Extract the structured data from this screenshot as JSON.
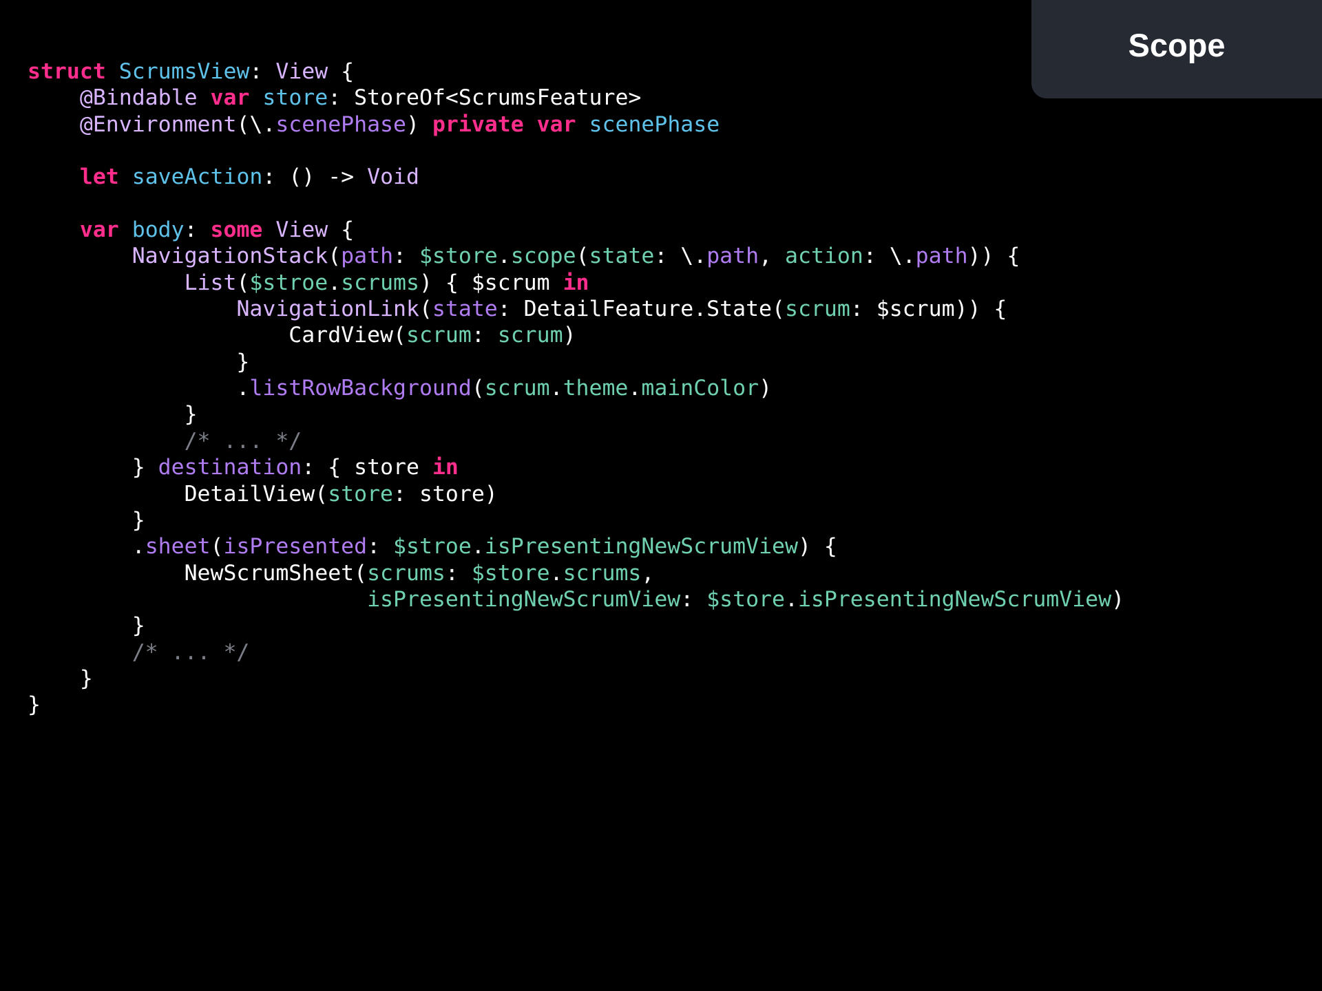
{
  "title_tab": {
    "title": "Scope"
  },
  "palette": {
    "background": "#000000",
    "tab_background": "#262a33",
    "keyword": "#ff2e8c",
    "type": "#d9b5ff",
    "name": "#5ec2ea",
    "member": "#b07cf2",
    "argument": "#6fd1b0",
    "comment": "#7b7f88",
    "plain": "#ffffff"
  },
  "code_lines": [
    [
      {
        "t": "struct",
        "k": "kw"
      },
      {
        "t": " ",
        "k": "plain"
      },
      {
        "t": "ScrumsView",
        "k": "name"
      },
      {
        "t": ": ",
        "k": "plain"
      },
      {
        "t": "View",
        "k": "type"
      },
      {
        "t": " {",
        "k": "plain"
      }
    ],
    [
      {
        "t": "    ",
        "k": "plain"
      },
      {
        "t": "@Bindable",
        "k": "attr"
      },
      {
        "t": " ",
        "k": "plain"
      },
      {
        "t": "var",
        "k": "kw"
      },
      {
        "t": " ",
        "k": "plain"
      },
      {
        "t": "store",
        "k": "name"
      },
      {
        "t": ": StoreOf<ScrumsFeature>",
        "k": "plain"
      }
    ],
    [
      {
        "t": "    ",
        "k": "plain"
      },
      {
        "t": "@Environment",
        "k": "attr"
      },
      {
        "t": "(\\.",
        "k": "plain"
      },
      {
        "t": "scenePhase",
        "k": "member"
      },
      {
        "t": ") ",
        "k": "plain"
      },
      {
        "t": "private",
        "k": "kw"
      },
      {
        "t": " ",
        "k": "plain"
      },
      {
        "t": "var",
        "k": "kw"
      },
      {
        "t": " ",
        "k": "plain"
      },
      {
        "t": "scenePhase",
        "k": "name"
      }
    ],
    [],
    [
      {
        "t": "    ",
        "k": "plain"
      },
      {
        "t": "let",
        "k": "kw"
      },
      {
        "t": " ",
        "k": "plain"
      },
      {
        "t": "saveAction",
        "k": "name"
      },
      {
        "t": ": () -> ",
        "k": "plain"
      },
      {
        "t": "Void",
        "k": "type"
      }
    ],
    [],
    [
      {
        "t": "    ",
        "k": "plain"
      },
      {
        "t": "var",
        "k": "kw"
      },
      {
        "t": " ",
        "k": "plain"
      },
      {
        "t": "body",
        "k": "name"
      },
      {
        "t": ": ",
        "k": "plain"
      },
      {
        "t": "some",
        "k": "kw"
      },
      {
        "t": " ",
        "k": "plain"
      },
      {
        "t": "View",
        "k": "type"
      },
      {
        "t": " {",
        "k": "plain"
      }
    ],
    [
      {
        "t": "        ",
        "k": "plain"
      },
      {
        "t": "NavigationStack",
        "k": "type"
      },
      {
        "t": "(",
        "k": "plain"
      },
      {
        "t": "path",
        "k": "member"
      },
      {
        "t": ": ",
        "k": "plain"
      },
      {
        "t": "$store",
        "k": "arg"
      },
      {
        "t": ".",
        "k": "plain"
      },
      {
        "t": "scope",
        "k": "arg"
      },
      {
        "t": "(",
        "k": "plain"
      },
      {
        "t": "state",
        "k": "arg"
      },
      {
        "t": ": \\.",
        "k": "plain"
      },
      {
        "t": "path",
        "k": "member"
      },
      {
        "t": ", ",
        "k": "plain"
      },
      {
        "t": "action",
        "k": "arg"
      },
      {
        "t": ": \\.",
        "k": "plain"
      },
      {
        "t": "path",
        "k": "member"
      },
      {
        "t": ")) {",
        "k": "plain"
      }
    ],
    [
      {
        "t": "            ",
        "k": "plain"
      },
      {
        "t": "List",
        "k": "type"
      },
      {
        "t": "(",
        "k": "plain"
      },
      {
        "t": "$stroe",
        "k": "arg"
      },
      {
        "t": ".",
        "k": "plain"
      },
      {
        "t": "scrums",
        "k": "arg"
      },
      {
        "t": ") { $scrum ",
        "k": "plain"
      },
      {
        "t": "in",
        "k": "kw"
      }
    ],
    [
      {
        "t": "                ",
        "k": "plain"
      },
      {
        "t": "NavigationLink",
        "k": "type"
      },
      {
        "t": "(",
        "k": "plain"
      },
      {
        "t": "state",
        "k": "member"
      },
      {
        "t": ": DetailFeature.State(",
        "k": "plain"
      },
      {
        "t": "scrum",
        "k": "arg"
      },
      {
        "t": ": $scrum)) {",
        "k": "plain"
      }
    ],
    [
      {
        "t": "                    ",
        "k": "plain"
      },
      {
        "t": "CardView",
        "k": "plain"
      },
      {
        "t": "(",
        "k": "plain"
      },
      {
        "t": "scrum",
        "k": "arg"
      },
      {
        "t": ": ",
        "k": "plain"
      },
      {
        "t": "scrum",
        "k": "arg"
      },
      {
        "t": ")",
        "k": "plain"
      }
    ],
    [
      {
        "t": "                }",
        "k": "plain"
      }
    ],
    [
      {
        "t": "                .",
        "k": "plain"
      },
      {
        "t": "listRowBackground",
        "k": "member"
      },
      {
        "t": "(",
        "k": "plain"
      },
      {
        "t": "scrum",
        "k": "arg"
      },
      {
        "t": ".",
        "k": "plain"
      },
      {
        "t": "theme",
        "k": "arg"
      },
      {
        "t": ".",
        "k": "plain"
      },
      {
        "t": "mainColor",
        "k": "arg"
      },
      {
        "t": ")",
        "k": "plain"
      }
    ],
    [
      {
        "t": "            }",
        "k": "plain"
      }
    ],
    [
      {
        "t": "            ",
        "k": "plain"
      },
      {
        "t": "/* ... */",
        "k": "comment"
      }
    ],
    [
      {
        "t": "        } ",
        "k": "plain"
      },
      {
        "t": "destination",
        "k": "member"
      },
      {
        "t": ": { store ",
        "k": "plain"
      },
      {
        "t": "in",
        "k": "kw"
      }
    ],
    [
      {
        "t": "            ",
        "k": "plain"
      },
      {
        "t": "DetailView",
        "k": "plain"
      },
      {
        "t": "(",
        "k": "plain"
      },
      {
        "t": "store",
        "k": "arg"
      },
      {
        "t": ": store)",
        "k": "plain"
      }
    ],
    [
      {
        "t": "        }",
        "k": "plain"
      }
    ],
    [
      {
        "t": "        .",
        "k": "plain"
      },
      {
        "t": "sheet",
        "k": "member"
      },
      {
        "t": "(",
        "k": "plain"
      },
      {
        "t": "isPresented",
        "k": "member"
      },
      {
        "t": ": ",
        "k": "plain"
      },
      {
        "t": "$stroe",
        "k": "arg"
      },
      {
        "t": ".",
        "k": "plain"
      },
      {
        "t": "isPresentingNewScrumView",
        "k": "arg"
      },
      {
        "t": ") {",
        "k": "plain"
      }
    ],
    [
      {
        "t": "            ",
        "k": "plain"
      },
      {
        "t": "NewScrumSheet",
        "k": "plain"
      },
      {
        "t": "(",
        "k": "plain"
      },
      {
        "t": "scrums",
        "k": "arg"
      },
      {
        "t": ": ",
        "k": "plain"
      },
      {
        "t": "$store",
        "k": "arg"
      },
      {
        "t": ".",
        "k": "plain"
      },
      {
        "t": "scrums",
        "k": "arg"
      },
      {
        "t": ",",
        "k": "plain"
      }
    ],
    [
      {
        "t": "                          ",
        "k": "plain"
      },
      {
        "t": "isPresentingNewScrumView",
        "k": "arg"
      },
      {
        "t": ": ",
        "k": "plain"
      },
      {
        "t": "$store",
        "k": "arg"
      },
      {
        "t": ".",
        "k": "plain"
      },
      {
        "t": "isPresentingNewScrumView",
        "k": "arg"
      },
      {
        "t": ")",
        "k": "plain"
      }
    ],
    [
      {
        "t": "        }",
        "k": "plain"
      }
    ],
    [
      {
        "t": "        ",
        "k": "plain"
      },
      {
        "t": "/* ... */",
        "k": "comment"
      }
    ],
    [
      {
        "t": "    }",
        "k": "plain"
      }
    ],
    [
      {
        "t": "}",
        "k": "plain"
      }
    ]
  ]
}
